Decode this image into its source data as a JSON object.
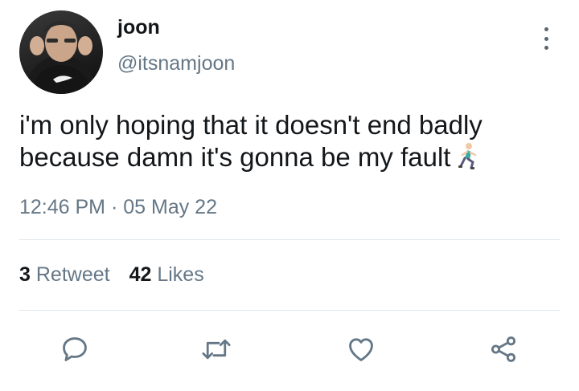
{
  "tweet": {
    "author_name": "joon",
    "author_handle": "@itsnamjoon",
    "text_line1": "i'm only hoping that it doesn't end badly",
    "text_line2": "because damn it's gonna be my fault",
    "emoji": "person-running-emoji",
    "time": "12:46 PM",
    "separator": "·",
    "date": "05 May 22"
  },
  "stats": {
    "retweet_count": "3",
    "retweet_label": "Retweet",
    "like_count": "42",
    "like_label": "Likes"
  },
  "actions": [
    "reply-icon",
    "retweet-icon",
    "like-icon",
    "share-icon"
  ],
  "colors": {
    "text": "#14171a",
    "secondary": "#657786",
    "icon": "#657786",
    "divider": "#e1e8ed"
  }
}
